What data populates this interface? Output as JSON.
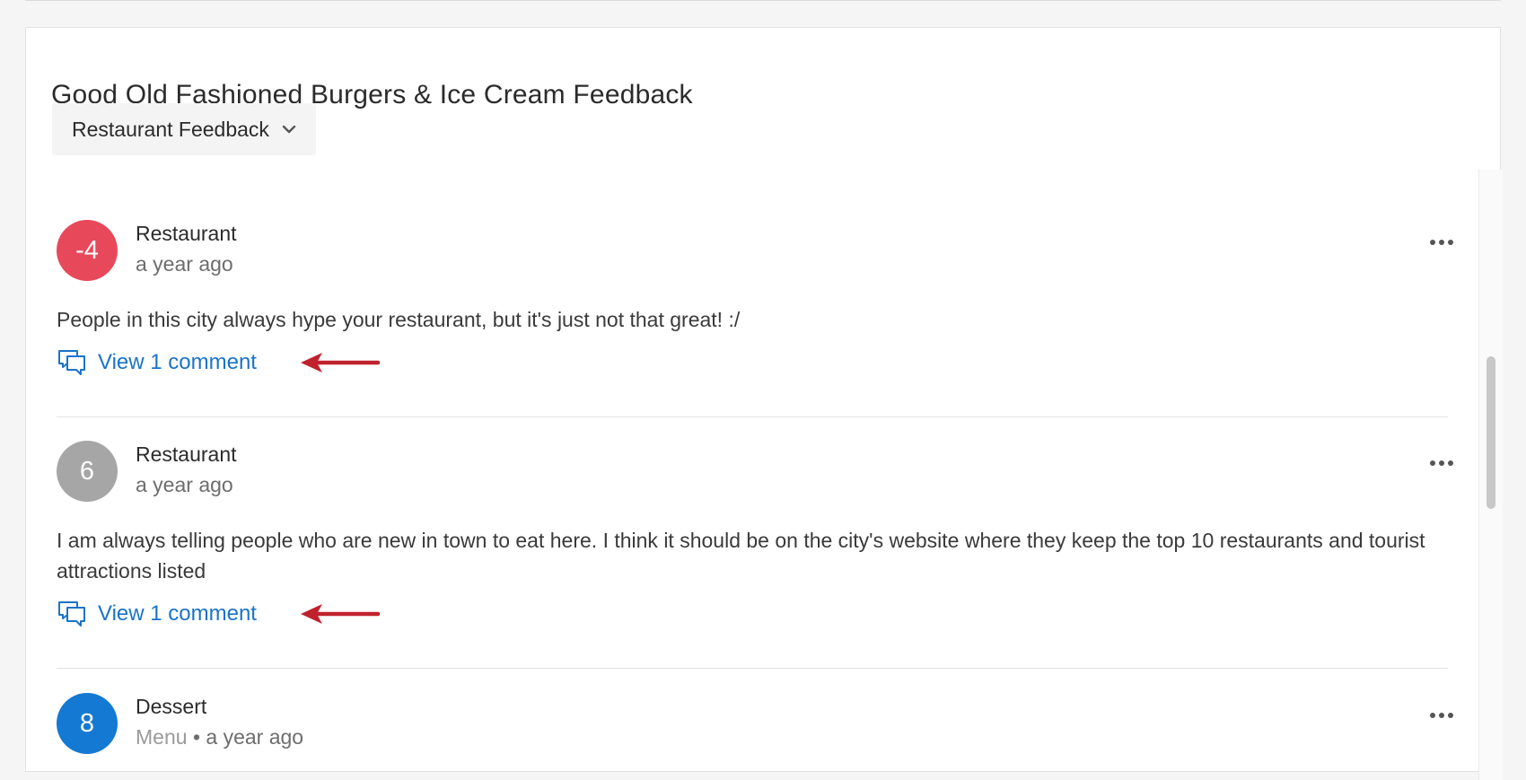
{
  "card": {
    "title": "Good Old Fashioned Burgers & Ice Cream Feedback",
    "dropdown_label": "Restaurant Feedback"
  },
  "colors": {
    "negative": "#e8495a",
    "neutral": "#a6a6a6",
    "positive": "#1479d2",
    "link": "#1a73c8",
    "annotation_arrow": "#c0222d"
  },
  "posts": [
    {
      "score": "-4",
      "author": "Restaurant",
      "category": "",
      "time": "a year ago",
      "text": "People in this city always hype your restaurant, but it's just not that great! :/",
      "comments_label": "View 1 comment"
    },
    {
      "score": "6",
      "author": "Restaurant",
      "category": "",
      "time": "a year ago",
      "text": "I am always telling people who are new in town to eat here. I think it should be on the city's website where they keep the top 10 restaurants and tourist attractions listed",
      "comments_label": "View 1 comment"
    },
    {
      "score": "8",
      "author": "Dessert",
      "category": "Menu",
      "separator": "•",
      "time": "a year ago"
    }
  ]
}
